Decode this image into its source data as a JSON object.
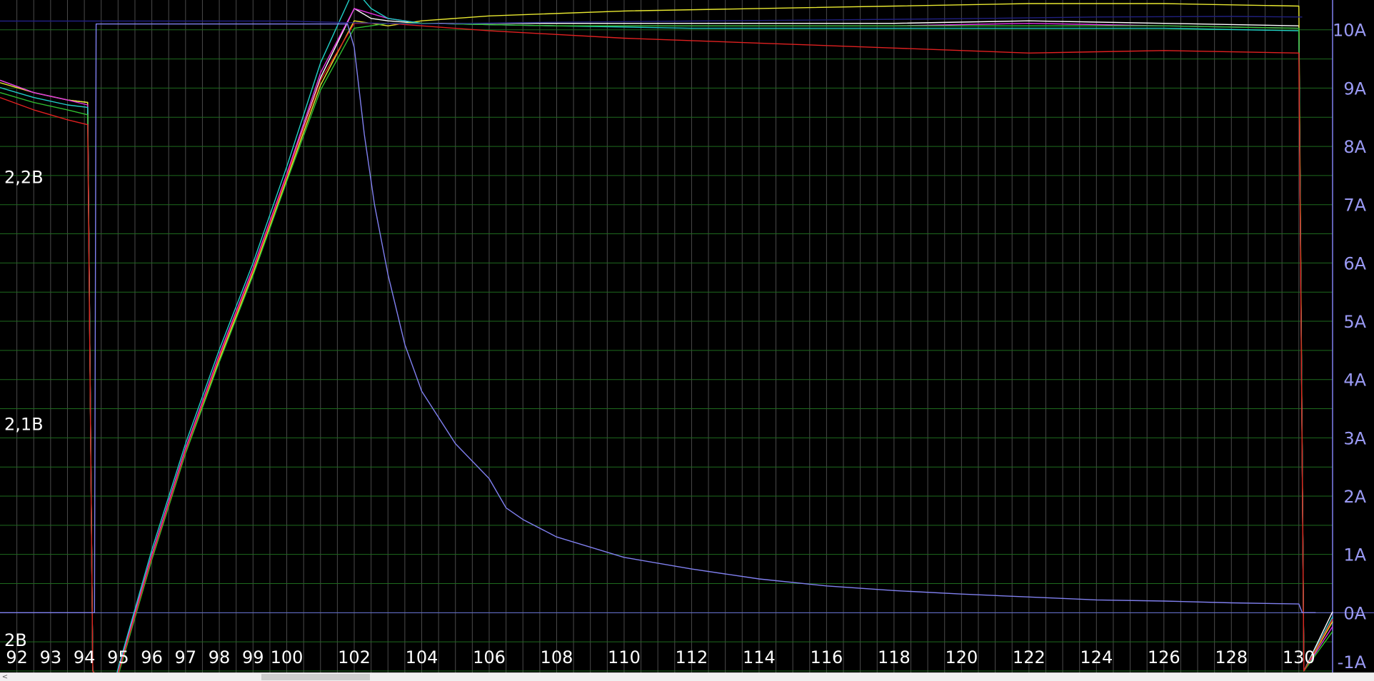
{
  "chart_data": {
    "type": "line",
    "x_range": [
      91.5,
      131.0
    ],
    "x_tick_labels": [
      "92",
      "93",
      "94",
      "95",
      "96",
      "97",
      "98",
      "99",
      "100",
      "102",
      "104",
      "106",
      "108",
      "110",
      "112",
      "114",
      "116",
      "118",
      "120",
      "122",
      "124",
      "126",
      "128",
      "130"
    ],
    "left_axis": {
      "unit": "V",
      "range": [
        2.0,
        2.27
      ],
      "tick_labels": [
        {
          "v": 2.2,
          "t": "2,2В"
        },
        {
          "v": 2.1,
          "t": "2,1В"
        },
        {
          "v": 2.0,
          "t": "2В"
        }
      ]
    },
    "right_axis": {
      "unit": "A",
      "range": [
        -1,
        10.45
      ],
      "tick_labels": [
        "10A",
        "9A",
        "8A",
        "7A",
        "6A",
        "5A",
        "4A",
        "3A",
        "2A",
        "1A",
        "0A",
        "-1A"
      ]
    },
    "grid": true,
    "background": "#000000",
    "series": [
      {
        "axis": "current",
        "color": "#8080f0",
        "points": [
          [
            91.5,
            0
          ],
          [
            94.3,
            0
          ],
          [
            94.35,
            10.1
          ],
          [
            98,
            10.1
          ],
          [
            101.8,
            10.1
          ],
          [
            102.0,
            9.7
          ],
          [
            102.3,
            8.2
          ],
          [
            102.6,
            7.0
          ],
          [
            103.0,
            5.8
          ],
          [
            103.5,
            4.6
          ],
          [
            104,
            3.8
          ],
          [
            105,
            2.9
          ],
          [
            106,
            2.3
          ],
          [
            106.5,
            1.8
          ],
          [
            107,
            1.6
          ],
          [
            108,
            1.3
          ],
          [
            110,
            0.95
          ],
          [
            112,
            0.75
          ],
          [
            114,
            0.58
          ],
          [
            116,
            0.46
          ],
          [
            118,
            0.38
          ],
          [
            120,
            0.32
          ],
          [
            122,
            0.27
          ],
          [
            124,
            0.22
          ],
          [
            126,
            0.2
          ],
          [
            128,
            0.17
          ],
          [
            130,
            0.15
          ],
          [
            130.1,
            0
          ],
          [
            130.5,
            0
          ]
        ]
      },
      {
        "axis": "voltage",
        "color": "#ffffff",
        "points": [
          [
            91.5,
            2.239
          ],
          [
            92.5,
            2.234
          ],
          [
            93.5,
            2.231
          ],
          [
            94.1,
            2.23
          ],
          [
            94.25,
            2.0
          ],
          [
            94.8,
            1.99
          ],
          [
            95,
            2.0
          ],
          [
            96,
            2.047
          ],
          [
            97,
            2.09
          ],
          [
            98,
            2.127
          ],
          [
            99,
            2.162
          ],
          [
            100,
            2.2
          ],
          [
            101,
            2.24
          ],
          [
            102,
            2.268
          ],
          [
            102.5,
            2.264
          ],
          [
            103,
            2.263
          ],
          [
            104,
            2.262
          ],
          [
            106,
            2.262
          ],
          [
            110,
            2.262
          ],
          [
            114,
            2.262
          ],
          [
            118,
            2.262
          ],
          [
            122,
            2.263
          ],
          [
            126,
            2.262
          ],
          [
            130,
            2.261
          ],
          [
            130.15,
            2.0
          ],
          [
            131,
            2.024
          ]
        ]
      },
      {
        "axis": "voltage",
        "color": "#e8e830",
        "points": [
          [
            91.5,
            2.238
          ],
          [
            92.5,
            2.234
          ],
          [
            93.5,
            2.231
          ],
          [
            94.1,
            2.23
          ],
          [
            94.25,
            2.0
          ],
          [
            94.8,
            1.99
          ],
          [
            95,
            1.999
          ],
          [
            96,
            2.046
          ],
          [
            97,
            2.089
          ],
          [
            98,
            2.126
          ],
          [
            99,
            2.161
          ],
          [
            100,
            2.199
          ],
          [
            101,
            2.237
          ],
          [
            102,
            2.263
          ],
          [
            103,
            2.261
          ],
          [
            104,
            2.263
          ],
          [
            106,
            2.265
          ],
          [
            110,
            2.267
          ],
          [
            114,
            2.268
          ],
          [
            118,
            2.269
          ],
          [
            122,
            2.27
          ],
          [
            126,
            2.27
          ],
          [
            130,
            2.269
          ],
          [
            130.15,
            2.0
          ],
          [
            131,
            2.02
          ]
        ]
      },
      {
        "axis": "voltage",
        "color": "#e030e0",
        "points": [
          [
            91.5,
            2.239
          ],
          [
            92.5,
            2.234
          ],
          [
            93.5,
            2.231
          ],
          [
            94.1,
            2.229
          ],
          [
            94.25,
            2.0
          ],
          [
            94.8,
            1.99
          ],
          [
            95,
            2.0
          ],
          [
            96,
            2.047
          ],
          [
            97,
            2.09
          ],
          [
            98,
            2.128
          ],
          [
            99,
            2.163
          ],
          [
            100,
            2.201
          ],
          [
            101,
            2.242
          ],
          [
            102,
            2.268
          ],
          [
            102.5,
            2.266
          ],
          [
            103,
            2.264
          ],
          [
            104,
            2.262
          ],
          [
            108,
            2.261
          ],
          [
            112,
            2.261
          ],
          [
            118,
            2.261
          ],
          [
            122,
            2.262
          ],
          [
            126,
            2.261
          ],
          [
            130,
            2.26
          ],
          [
            130.15,
            2.0
          ],
          [
            131,
            2.018
          ]
        ]
      },
      {
        "axis": "voltage",
        "color": "#20d0c8",
        "points": [
          [
            91.5,
            2.236
          ],
          [
            92.5,
            2.232
          ],
          [
            93.5,
            2.229
          ],
          [
            94.1,
            2.228
          ],
          [
            94.25,
            2.0
          ],
          [
            94.8,
            1.99
          ],
          [
            95,
            2.001
          ],
          [
            96,
            2.049
          ],
          [
            97,
            2.092
          ],
          [
            98,
            2.13
          ],
          [
            99,
            2.165
          ],
          [
            100,
            2.204
          ],
          [
            101,
            2.246
          ],
          [
            102,
            2.276
          ],
          [
            102.5,
            2.268
          ],
          [
            103,
            2.264
          ],
          [
            104,
            2.262
          ],
          [
            108,
            2.261
          ],
          [
            112,
            2.26
          ],
          [
            118,
            2.26
          ],
          [
            122,
            2.26
          ],
          [
            126,
            2.26
          ],
          [
            130,
            2.259
          ],
          [
            130.15,
            2.0
          ],
          [
            131,
            2.022
          ]
        ]
      },
      {
        "axis": "voltage",
        "color": "#30c030",
        "points": [
          [
            91.5,
            2.234
          ],
          [
            92.5,
            2.23
          ],
          [
            93.5,
            2.227
          ],
          [
            94.1,
            2.225
          ],
          [
            94.25,
            2.0
          ],
          [
            94.8,
            1.99
          ],
          [
            95,
            1.998
          ],
          [
            96,
            2.045
          ],
          [
            97,
            2.088
          ],
          [
            98,
            2.125
          ],
          [
            99,
            2.16
          ],
          [
            100,
            2.198
          ],
          [
            101,
            2.235
          ],
          [
            102,
            2.26
          ],
          [
            103,
            2.262
          ],
          [
            104,
            2.262
          ],
          [
            108,
            2.261
          ],
          [
            112,
            2.261
          ],
          [
            118,
            2.261
          ],
          [
            122,
            2.261
          ],
          [
            126,
            2.261
          ],
          [
            130,
            2.26
          ],
          [
            130.15,
            2.0
          ],
          [
            131,
            2.016
          ]
        ]
      },
      {
        "axis": "voltage",
        "color": "#e02020",
        "points": [
          [
            91.5,
            2.232
          ],
          [
            92.5,
            2.227
          ],
          [
            93.5,
            2.223
          ],
          [
            94.1,
            2.221
          ],
          [
            94.25,
            2.0
          ],
          [
            94.8,
            1.99
          ],
          [
            95,
            1.999
          ],
          [
            96,
            2.046
          ],
          [
            97,
            2.089
          ],
          [
            98,
            2.127
          ],
          [
            99,
            2.162
          ],
          [
            100,
            2.2
          ],
          [
            101,
            2.239
          ],
          [
            102,
            2.262
          ],
          [
            103,
            2.262
          ],
          [
            104,
            2.261
          ],
          [
            106,
            2.259
          ],
          [
            110,
            2.256
          ],
          [
            114,
            2.254
          ],
          [
            118,
            2.252
          ],
          [
            122,
            2.25
          ],
          [
            126,
            2.251
          ],
          [
            130,
            2.25
          ],
          [
            130.15,
            2.0
          ],
          [
            131,
            2.021
          ]
        ]
      },
      {
        "axis": "current",
        "color": "#202080",
        "points": [
          [
            91.5,
            10.15
          ],
          [
            94.3,
            10.15
          ],
          [
            100,
            10.15
          ],
          [
            102,
            10.12
          ],
          [
            104,
            10.1
          ],
          [
            108,
            10.13
          ],
          [
            112,
            10.15
          ],
          [
            116,
            10.17
          ],
          [
            120,
            10.19
          ],
          [
            124,
            10.22
          ],
          [
            128,
            10.23
          ],
          [
            130.1,
            10.22
          ]
        ]
      }
    ]
  }
}
